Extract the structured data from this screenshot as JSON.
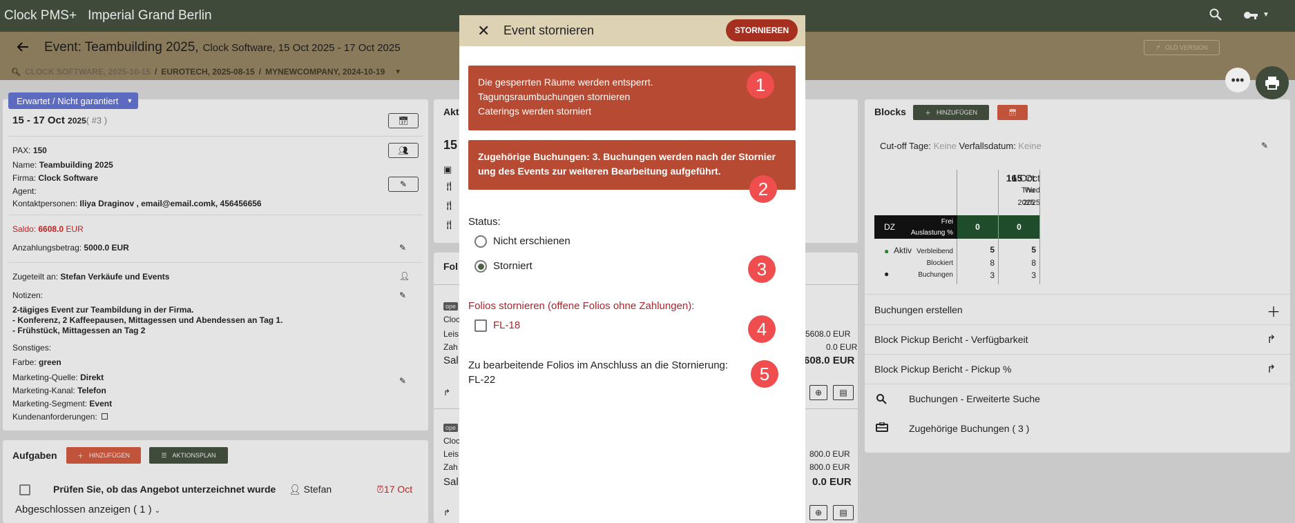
{
  "topbar": {
    "app": "Clock PMS+",
    "hotel": "Imperial Grand Berlin"
  },
  "header": {
    "title": "Event: Teambuilding 2025,",
    "subtitle": "Clock Software, 15 Oct 2025 - 17 Oct 2025",
    "old_version": "OLD VERSION"
  },
  "breadcrumbs": [
    "CLOCK SOFTWARE, 2025-10-15",
    "EUROTECH, 2025-08-15",
    "MYNEWCOMPANY, 2024-10-19"
  ],
  "left": {
    "status": "Erwartet / Nicht garantiert",
    "dates": "15 - 17 Oct",
    "year": "2025",
    "num": "( #3 )",
    "pax_label": "PAX:",
    "pax": "150",
    "name_label": "Name:",
    "name": "Teambuilding 2025",
    "firm_label": "Firma:",
    "firm": "Clock Software",
    "agent_label": "Agent:",
    "contact_label": "Kontaktpersonen:",
    "contact": "Iliya Draginov , email@email.comk, 456456656",
    "saldo_label": "Saldo:",
    "saldo": "6608.0",
    "saldo_cur": "EUR",
    "deposit_label": "Anzahlungsbetrag:",
    "deposit": "5000.0 EUR",
    "assigned_label": "Zugeteilt an:",
    "assigned": "Stefan  Verkäufe und Events",
    "notes_label": "Notizen:",
    "notes": [
      "2-tägiges Event zur Teambildung in der Firma.",
      "- Konferenz, 2 Kaffeepausen, Mittagessen und Abendessen an Tag 1.",
      "- Frühstück, Mittagessen an Tag 2"
    ],
    "misc_label": "Sonstiges:",
    "color_label": "Farbe:",
    "color": "green",
    "msource_label": "Marketing-Quelle:",
    "msource": "Direkt",
    "mchannel_label": "Marketing-Kanal:",
    "mchannel": "Telefon",
    "msegment_label": "Marketing-Segment:",
    "msegment": "Event",
    "custreq_label": "Kundenanforderungen:"
  },
  "tasks": {
    "title": "Aufgaben",
    "add": "HINZUFÜGEN",
    "plan": "AKTIONSPLAN",
    "item": "Prüfen Sie, ob das Angebot unterzeichnet wurde",
    "assignee": "Stefan",
    "due": "17 Oct",
    "completed": "Abgeschlossen anzeigen ( 1 )"
  },
  "middle": {
    "act_title": "Akt",
    "act_date": "15",
    "fol_title": "Fol",
    "f1": {
      "tag": "ope",
      "c": "Cloc",
      "leis": "Leis",
      "zah": "Zah",
      "sal": "Sal",
      "v1": "5608.0 EUR",
      "v2": "0.0 EUR",
      "v3": "608.0 EUR"
    },
    "f2": {
      "tag": "ope",
      "c": "Cloc",
      "leis": "Leis",
      "zah": "Zah",
      "sal": "Sal",
      "v1": "800.0 EUR",
      "v2": "800.0 EUR",
      "v3": "0.0 EUR"
    }
  },
  "blocks": {
    "title": "Blocks",
    "add": "HINZUFÜGEN",
    "cutoff_label": "Cut-off Tage:",
    "cutoff": "Keine",
    "expiry_label": "Verfallsdatum:",
    "expiry": "Keine",
    "days": [
      {
        "d": "15",
        "m": "Oct",
        "w": "Wed",
        "y": "2025"
      },
      {
        "d": "16",
        "m": "Oct",
        "w": "Thu",
        "y": "2025"
      }
    ],
    "room": "DZ",
    "frei": "Frei",
    "auslastung": "Auslastung %",
    "vals": [
      "0",
      "0"
    ],
    "aktiv": "Aktiv",
    "verbleibend": "Verbleibend",
    "blockiert": "Blockiert",
    "buchungen": "Buchungen",
    "verb": [
      "5",
      "5"
    ],
    "block": [
      "8",
      "8"
    ],
    "buch": [
      "3",
      "3"
    ],
    "links": [
      "Buchungen erstellen",
      "Block Pickup Bericht - Verfügbarkeit",
      "Block Pickup Bericht - Pickup %"
    ],
    "search": "Buchungen - Erweiterte Suche",
    "related": "Zugehörige Buchungen ( 3 )"
  },
  "modal": {
    "title": "Event stornieren",
    "button": "STORNIEREN",
    "alert1": [
      "Die gesperrten Räume werden entsperrt.",
      "Tagungsraumbuchungen stornieren",
      "Caterings werden storniert"
    ],
    "alert2": "Zugehörige Buchungen: 3. Buchungen werden nach der Stornier ung des Events zur weiteren Bearbeitung aufgeführt.",
    "status_label": "Status:",
    "opt1": "Nicht erschienen",
    "opt2": "Storniert",
    "folios_label": "Folios stornieren (offene Folios ohne Zahlungen):",
    "folio": "FL-18",
    "after_label": "Zu bearbeitende Folios im Anschluss an die Stornierung:",
    "after_folio": "FL-22",
    "badges": [
      "1",
      "2",
      "3",
      "4",
      "5"
    ]
  }
}
